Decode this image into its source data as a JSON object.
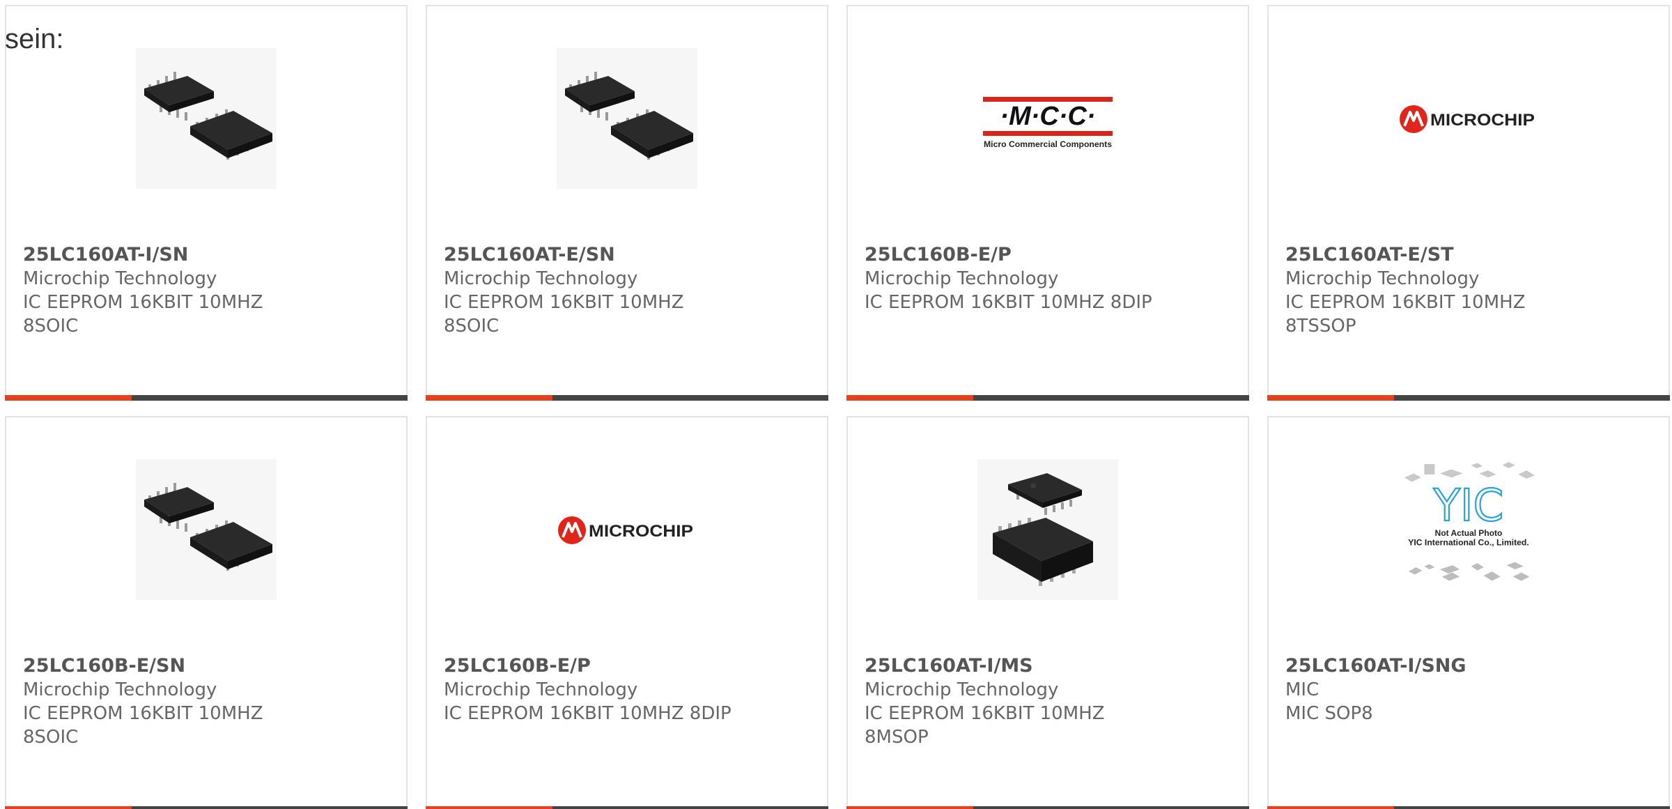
{
  "intro": "sein:",
  "colors": {
    "accent": "#e8401c",
    "bar_dark": "#444444",
    "mcc_red": "#d5261c",
    "microchip_red": "#e1251b",
    "yic_blue": "#2aa3d8"
  },
  "cards": [
    {
      "part": "25LC160AT-I/SN",
      "maker": "Microchip Technology",
      "desc": "IC EEPROM 16KBIT 10MHZ 8SOIC",
      "image": "soic8-chip-photo"
    },
    {
      "part": "25LC160AT-E/SN",
      "maker": "Microchip Technology",
      "desc": "IC EEPROM 16KBIT 10MHZ 8SOIC",
      "image": "soic8-chip-photo"
    },
    {
      "part": "25LC160B-E/P",
      "maker": "Microchip Technology",
      "desc": "IC EEPROM 16KBIT 10MHZ 8DIP",
      "image": "mcc-logo",
      "logo_text": "·M·C·C·",
      "logo_sub": "Micro Commercial Components"
    },
    {
      "part": "25LC160AT-E/ST",
      "maker": "Microchip Technology",
      "desc": "IC EEPROM 16KBIT 10MHZ 8TSSOP",
      "image": "microchip-logo",
      "logo_text": "MICROCHIP"
    },
    {
      "part": "25LC160B-E/SN",
      "maker": "Microchip Technology",
      "desc": "IC EEPROM 16KBIT 10MHZ 8SOIC",
      "image": "soic8-chip-photo"
    },
    {
      "part": "25LC160B-E/P",
      "maker": "Microchip Technology",
      "desc": "IC EEPROM 16KBIT 10MHZ 8DIP",
      "image": "microchip-logo",
      "logo_text": "MICROCHIP"
    },
    {
      "part": "25LC160AT-I/MS",
      "maker": "Microchip Technology",
      "desc": "IC EEPROM 16KBIT 10MHZ 8MSOP",
      "image": "msop8-chip-photo"
    },
    {
      "part": "25LC160AT-I/SNG",
      "maker": "MIC",
      "desc": "MIC SOP8",
      "image": "yic-not-actual-photo",
      "logo_text": "YIC",
      "logo_line1": "Not Actual Photo",
      "logo_line2": "YIC International Co., Limited."
    }
  ]
}
